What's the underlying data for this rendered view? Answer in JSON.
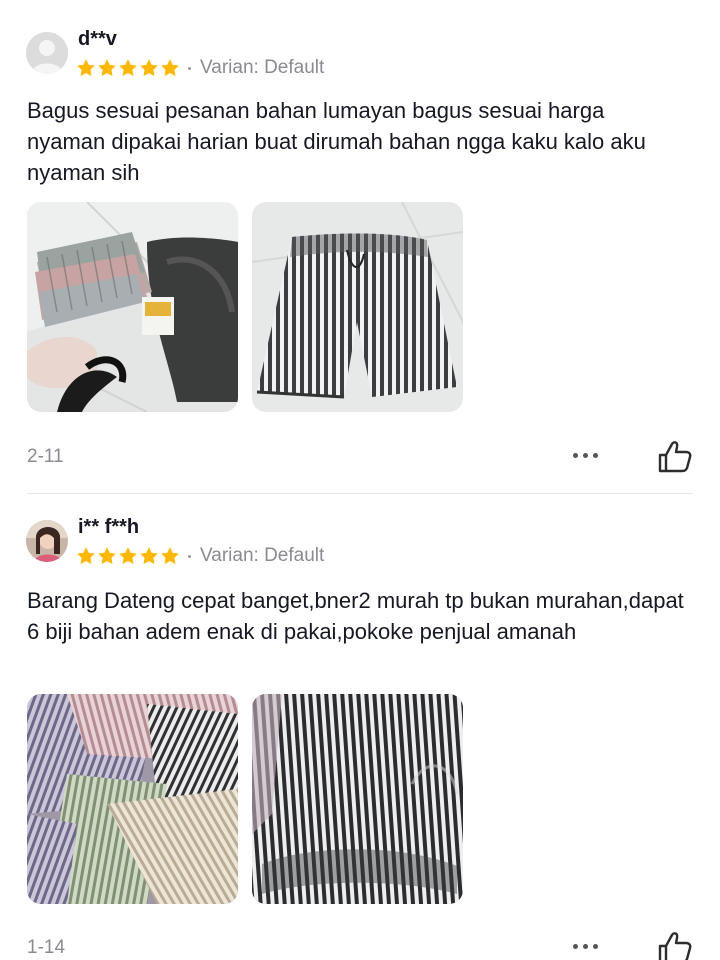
{
  "reviews": [
    {
      "username": "d**v",
      "rating": 5,
      "variant": "Varian: Default",
      "text": "Bagus sesuai pesanan bahan lumayan bagus sesuai harga nyaman dipakai harian buat dirumah bahan ngga kaku kalo aku nyaman sih",
      "date": "2-11",
      "avatar_icon": "default-user-avatar",
      "photos": [
        "photo-shorts-bundle",
        "photo-striped-shorts"
      ]
    },
    {
      "username": "i** f**h",
      "rating": 5,
      "variant": "Varian: Default",
      "text": "Barang Dateng cepat banget,bner2 murah tp bukan murahan,dapat 6 biji bahan adem enak di pakai,pokoke penjual amanah",
      "date": "1-14",
      "avatar_icon": "user-photo-avatar",
      "photos": [
        "photo-colored-shorts-pile",
        "photo-striped-shorts"
      ]
    }
  ],
  "colors": {
    "star": "#FFB800",
    "secondary_text": "#8a8b91",
    "divider": "#e6e6e6"
  },
  "icons": {
    "more": "more-dots-icon",
    "like": "thumbs-up-icon",
    "star": "star-icon"
  }
}
